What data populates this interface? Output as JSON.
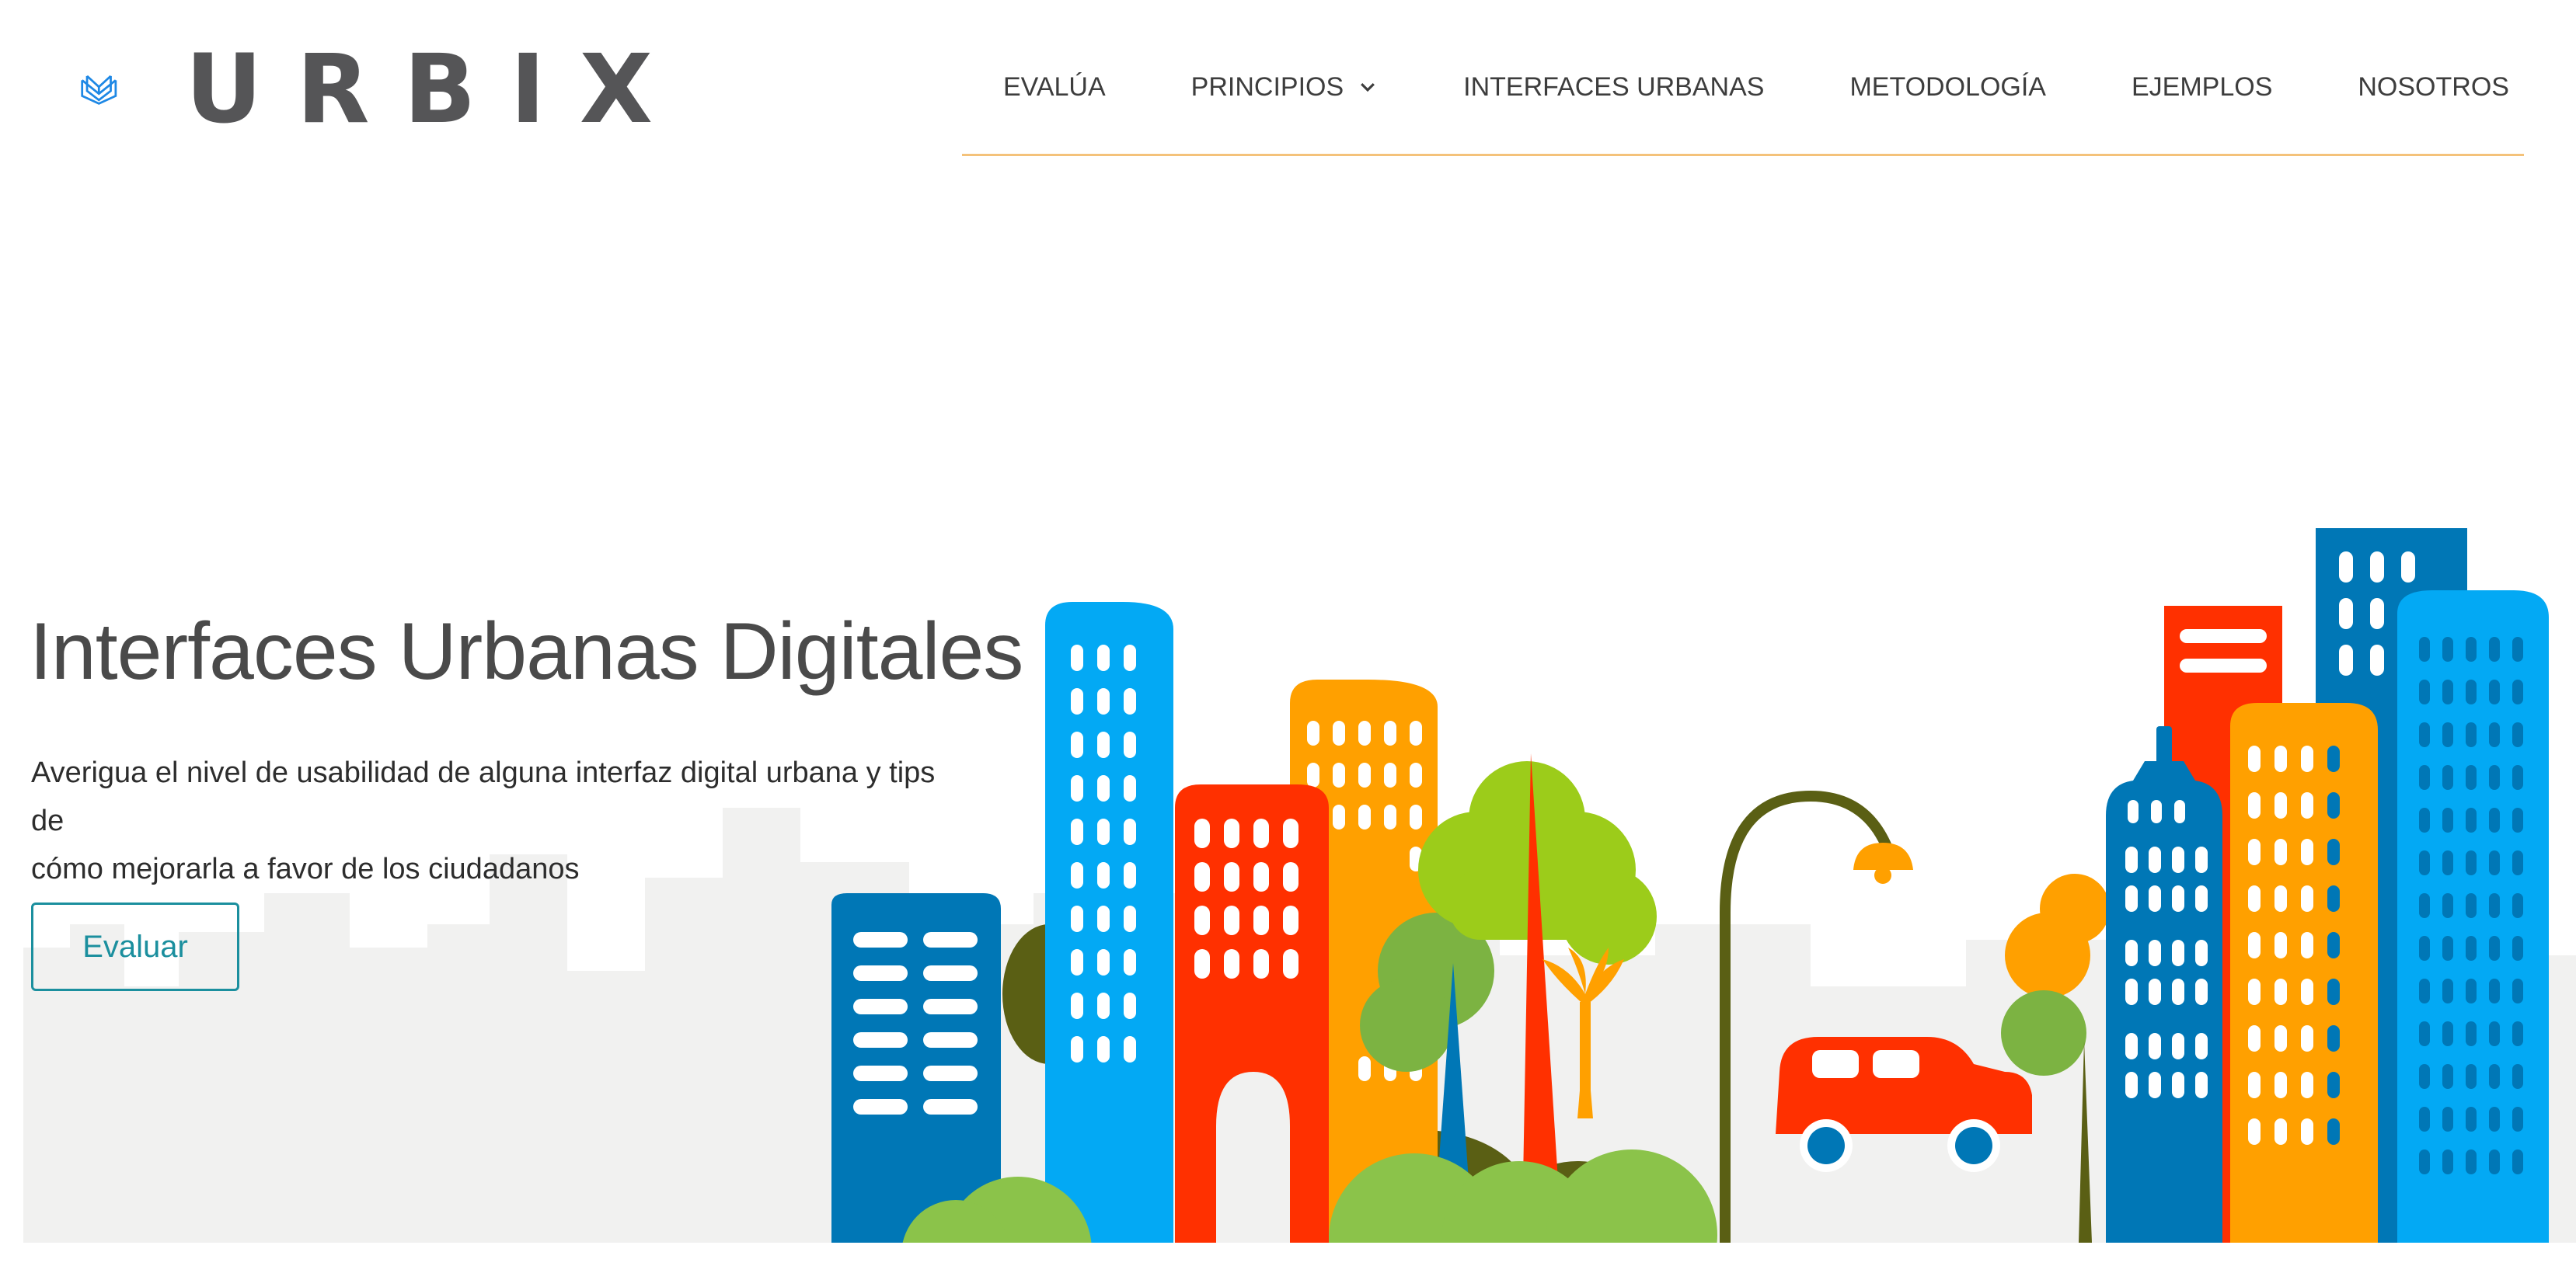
{
  "brand": {
    "name": "URBIX",
    "color_primary": "#1e88e5",
    "color_text": "#555557",
    "logo_icon": "open-book-shield-icon"
  },
  "nav": {
    "items": [
      {
        "label": "EVALÚA"
      },
      {
        "label": "PRINCIPIOS",
        "has_dropdown": true,
        "dropdown_icon": "chevron-down-icon"
      },
      {
        "label": "INTERFACES URBANAS"
      },
      {
        "label": "METODOLOGÍA"
      },
      {
        "label": "EJEMPLOS"
      },
      {
        "label": "NOSOTROS"
      }
    ],
    "underline_color": "#f4c27a"
  },
  "hero": {
    "title": "Interfaces Urbanas Digitales",
    "subtitle_line1": "Averigua el nivel de usabilidad de alguna interfaz digital urbana y tips de",
    "subtitle_line2": "cómo mejorarla a favor de los ciudadanos",
    "button_label": "Evaluar",
    "button_color": "#1b8f9e",
    "illustration": "city-skyline-illustration"
  },
  "colors": {
    "building_blue": "#0077b6",
    "building_cyan": "#03a9f4",
    "building_red": "#ff3000",
    "building_orange": "#ffa000",
    "tree_green": "#8bc34a",
    "tree_olive": "#5a5f14",
    "skyline_gray": "#f0f0ef"
  }
}
